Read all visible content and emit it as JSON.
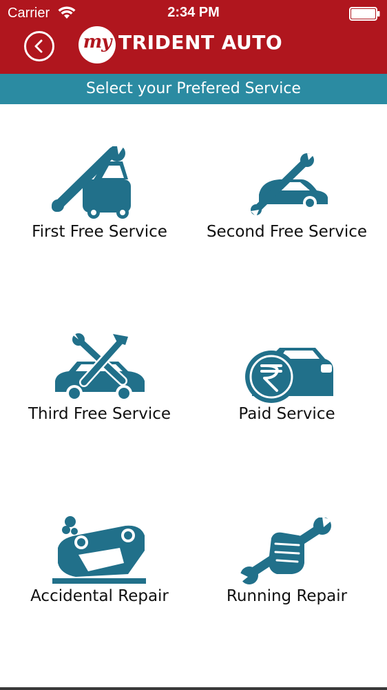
{
  "status_bar": {
    "carrier": "Carrier",
    "time": "2:34 PM"
  },
  "nav": {
    "logo_badge": "my",
    "brand": "TRIDENT AUTO"
  },
  "sub_header": {
    "title": "Select your Prefered Service"
  },
  "services": [
    {
      "label": "First Free Service",
      "icon": "car-wrench-icon"
    },
    {
      "label": "Second Free Service",
      "icon": "car-small-wrench-icon"
    },
    {
      "label": "Third Free Service",
      "icon": "car-tools-icon"
    },
    {
      "label": "Paid Service",
      "icon": "car-rupee-icon"
    },
    {
      "label": "Accidental Repair",
      "icon": "overturned-car-icon"
    },
    {
      "label": "Running Repair",
      "icon": "hand-wrench-icon"
    }
  ],
  "colors": {
    "header": "#b0161e",
    "sub_header": "#2b8ba2",
    "icon": "#21708a"
  }
}
